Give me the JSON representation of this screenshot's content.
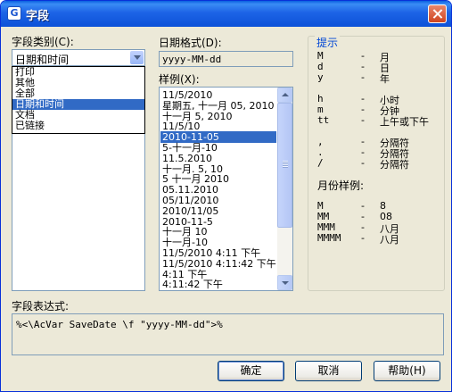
{
  "window": {
    "title": "字段"
  },
  "category": {
    "label": "字段类别(C):",
    "selected": "日期和时间",
    "options": [
      "打印",
      "其他",
      "全部",
      "日期和时间",
      "文档",
      "已链接"
    ]
  },
  "date_format": {
    "label": "日期格式(D):",
    "value": "yyyy-MM-dd"
  },
  "examples": {
    "label": "样例(X):",
    "selected": "2010-11-05",
    "items": [
      "11/5/2010",
      "星期五, 十一月 05, 2010",
      "十一月 5, 2010",
      "11/5/10",
      "2010-11-05",
      "5-十一月-10",
      "11.5.2010",
      "十一月. 5, 10",
      "5 十一月 2010",
      "05.11.2010",
      "05/11/2010",
      "2010/11/05",
      "2010-11-5",
      "十一月 10",
      "十一月-10",
      "11/5/2010 4:11 下午",
      "11/5/2010 4:11:42 下午",
      "4:11 下午",
      "4:11:42 下午"
    ]
  },
  "hints": {
    "title": "提示",
    "rows": [
      {
        "code": "M",
        "dash": "-",
        "desc": "月"
      },
      {
        "code": "d",
        "dash": "-",
        "desc": "日"
      },
      {
        "code": "y",
        "dash": "-",
        "desc": "年"
      },
      {
        "code": "h",
        "dash": "-",
        "desc": "小时"
      },
      {
        "code": "m",
        "dash": "-",
        "desc": "分钟"
      },
      {
        "code": "tt",
        "dash": "-",
        "desc": "上午或下午"
      },
      {
        "code": ",",
        "dash": "-",
        "desc": "分隔符"
      },
      {
        "code": ".",
        "dash": "-",
        "desc": "分隔符"
      },
      {
        "code": "/",
        "dash": "-",
        "desc": "分隔符"
      }
    ],
    "month_title": "月份样例:",
    "month_rows": [
      {
        "code": "M",
        "dash": "-",
        "desc": "8"
      },
      {
        "code": "MM",
        "dash": "-",
        "desc": "08"
      },
      {
        "code": "MMM",
        "dash": "-",
        "desc": "八月"
      },
      {
        "code": "MMMM",
        "dash": "-",
        "desc": "八月"
      }
    ]
  },
  "expression": {
    "label": "字段表达式:",
    "value": "%<\\AcVar SaveDate \\f \"yyyy-MM-dd\">%"
  },
  "buttons": {
    "ok": "确定",
    "cancel": "取消",
    "help": "帮助(H)"
  }
}
